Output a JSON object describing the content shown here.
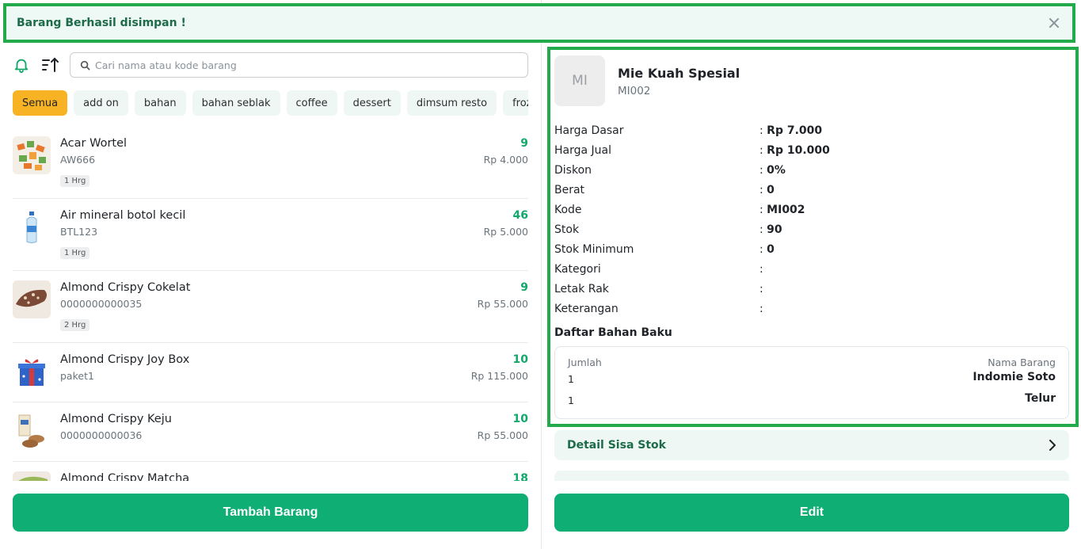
{
  "toast": {
    "message": "Barang Berhasil disimpan !"
  },
  "search": {
    "placeholder": "Cari nama atau kode barang"
  },
  "categories": [
    "Semua",
    "add on",
    "bahan",
    "bahan seblak",
    "coffee",
    "dessert",
    "dimsum resto",
    "frozen"
  ],
  "items": [
    {
      "name": "Acar Wortel",
      "code": "AW666",
      "badge": "1 Hrg",
      "stock": "9",
      "price": "Rp 4.000"
    },
    {
      "name": "Air mineral botol kecil",
      "code": "BTL123",
      "badge": "1 Hrg",
      "stock": "46",
      "price": "Rp 5.000"
    },
    {
      "name": "Almond Crispy Cokelat",
      "code": "0000000000035",
      "badge": "2 Hrg",
      "stock": "9",
      "price": "Rp 55.000"
    },
    {
      "name": "Almond Crispy Joy Box",
      "code": "paket1",
      "badge": "",
      "stock": "10",
      "price": "Rp 115.000"
    },
    {
      "name": "Almond Crispy Keju",
      "code": "0000000000036",
      "badge": "",
      "stock": "10",
      "price": "Rp 55.000"
    },
    {
      "name": "Almond Crispy Matcha",
      "code": "",
      "badge": "",
      "stock": "18",
      "price": ""
    }
  ],
  "add_button": "Tambah Barang",
  "detail": {
    "avatar": "MI",
    "name": "Mie Kuah Spesial",
    "code": "MI002",
    "fields": [
      {
        "label": "Harga Dasar",
        "value": "Rp 7.000"
      },
      {
        "label": "Harga Jual",
        "value": "Rp 10.000"
      },
      {
        "label": "Diskon",
        "value": "0%"
      },
      {
        "label": "Berat",
        "value": "0"
      },
      {
        "label": "Kode",
        "value": "MI002"
      },
      {
        "label": "Stok",
        "value": "90"
      },
      {
        "label": "Stok Minimum",
        "value": "0"
      },
      {
        "label": "Kategori",
        "value": ""
      },
      {
        "label": "Letak Rak",
        "value": ""
      },
      {
        "label": "Keterangan",
        "value": ""
      }
    ],
    "bahan_title": "Daftar Bahan Baku",
    "bahan_headers": {
      "qty": "Jumlah",
      "name": "Nama Barang"
    },
    "bahan": [
      {
        "qty": "1",
        "name": "Indomie Soto"
      },
      {
        "qty": "1",
        "name": "Telur"
      }
    ]
  },
  "detail_stok": "Detail Sisa Stok",
  "edit_button": "Edit",
  "colors": {
    "primary": "#0fae75",
    "chip_active": "#f8b324",
    "highlight_border": "#22aa4b"
  }
}
